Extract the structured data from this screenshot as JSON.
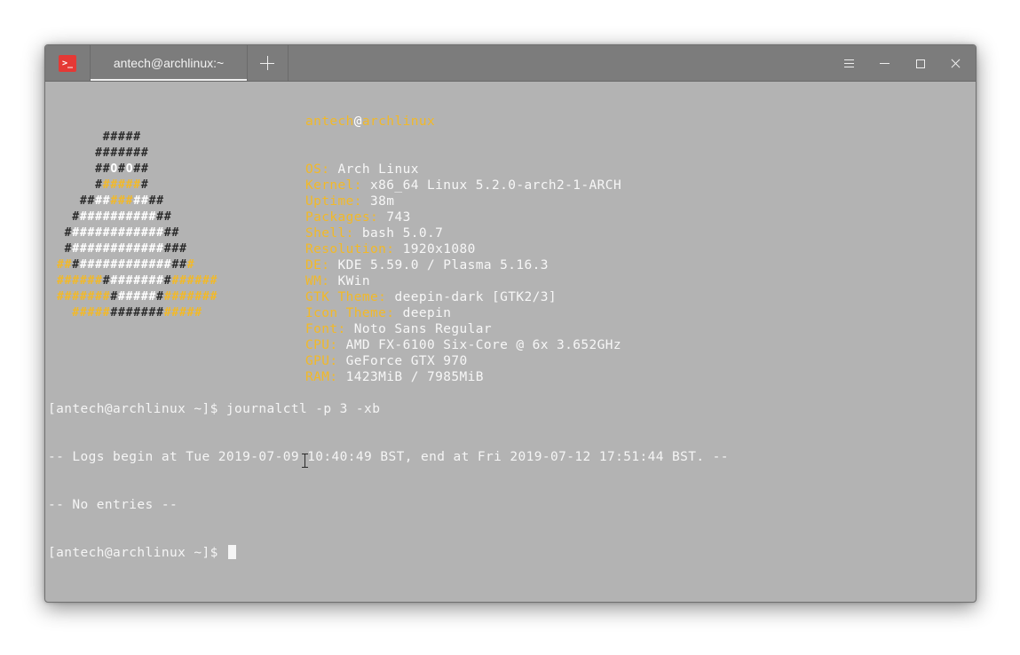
{
  "tab": {
    "title": "antech@archlinux:~"
  },
  "icons": {
    "app": "terminal-icon",
    "add_tab": "plus-icon",
    "menu": "hamburger-menu-icon",
    "minimize": "minimize-icon",
    "maximize": "maximize-icon",
    "close": "close-icon",
    "pointer": "text-ibeam-cursor-icon"
  },
  "app_icon_glyph": ">_",
  "colors": {
    "terminal_bg": "#b3b3b3",
    "titlebar_bg": "#7c7c7c",
    "accent_yellow": "#f2b928",
    "text_white": "#f7f7f7",
    "logo_dark": "#2b2b2b",
    "app_icon_red": "#e53935"
  },
  "neofetch": {
    "user": "antech",
    "at": "@",
    "host": "archlinux",
    "rows": [
      {
        "key": "OS: ",
        "value": "Arch Linux"
      },
      {
        "key": "Kernel: ",
        "value": "x86_64 Linux 5.2.0-arch2-1-ARCH"
      },
      {
        "key": "Uptime: ",
        "value": "38m"
      },
      {
        "key": "Packages: ",
        "value": "743"
      },
      {
        "key": "Shell: ",
        "value": "bash 5.0.7"
      },
      {
        "key": "Resolution: ",
        "value": "1920x1080"
      },
      {
        "key": "DE: ",
        "value": "KDE 5.59.0 / Plasma 5.16.3"
      },
      {
        "key": "WM: ",
        "value": "KWin"
      },
      {
        "key": "GTK Theme: ",
        "value": "deepin-dark [GTK2/3]"
      },
      {
        "key": "Icon Theme: ",
        "value": "deepin"
      },
      {
        "key": "Font: ",
        "value": "Noto Sans Regular"
      },
      {
        "key": "CPU: ",
        "value": "AMD FX-6100 Six-Core @ 6x 3.652GHz"
      },
      {
        "key": "GPU: ",
        "value": "GeForce GTX 970"
      },
      {
        "key": "RAM: ",
        "value": "1423MiB / 7985MiB"
      }
    ]
  },
  "logo_lines": [
    [
      [
        "      ",
        "d"
      ],
      [
        "#####",
        "d"
      ]
    ],
    [
      [
        "     ",
        "d"
      ],
      [
        "#######",
        "d"
      ]
    ],
    [
      [
        "     ",
        "d"
      ],
      [
        "##",
        "d"
      ],
      [
        "O",
        "w"
      ],
      [
        "#",
        "d"
      ],
      [
        "O",
        "w"
      ],
      [
        "##",
        "d"
      ]
    ],
    [
      [
        "     ",
        "d"
      ],
      [
        "#",
        "d"
      ],
      [
        "#####",
        "y"
      ],
      [
        "#",
        "d"
      ]
    ],
    [
      [
        "   ",
        "d"
      ],
      [
        "##",
        "d"
      ],
      [
        "##",
        "w"
      ],
      [
        "###",
        "y"
      ],
      [
        "##",
        "w"
      ],
      [
        "##",
        "d"
      ]
    ],
    [
      [
        "  ",
        "d"
      ],
      [
        "#",
        "d"
      ],
      [
        "##########",
        "w"
      ],
      [
        "##",
        "d"
      ]
    ],
    [
      [
        " ",
        "d"
      ],
      [
        "#",
        "d"
      ],
      [
        "############",
        "w"
      ],
      [
        "##",
        "d"
      ]
    ],
    [
      [
        " ",
        "d"
      ],
      [
        "#",
        "d"
      ],
      [
        "############",
        "w"
      ],
      [
        "###",
        "d"
      ]
    ],
    [
      [
        "##",
        "y"
      ],
      [
        "#",
        "d"
      ],
      [
        "############",
        "w"
      ],
      [
        "##",
        "d"
      ],
      [
        "#",
        "y"
      ]
    ],
    [
      [
        "######",
        "y"
      ],
      [
        "#",
        "d"
      ],
      [
        "#######",
        "w"
      ],
      [
        "#",
        "d"
      ],
      [
        "######",
        "y"
      ]
    ],
    [
      [
        "#######",
        "y"
      ],
      [
        "#",
        "d"
      ],
      [
        "#####",
        "w"
      ],
      [
        "#",
        "d"
      ],
      [
        "#######",
        "y"
      ]
    ],
    [
      [
        "  ",
        "d"
      ],
      [
        "#####",
        "y"
      ],
      [
        "#######",
        "d"
      ],
      [
        "#####",
        "y"
      ]
    ]
  ],
  "console": [
    "[antech@archlinux ~]$ journalctl -p 3 -xb",
    "-- Logs begin at Tue 2019-07-09 10:40:49 BST, end at Fri 2019-07-12 17:51:44 BST. --",
    "-- No entries --",
    "[antech@archlinux ~]$ "
  ]
}
